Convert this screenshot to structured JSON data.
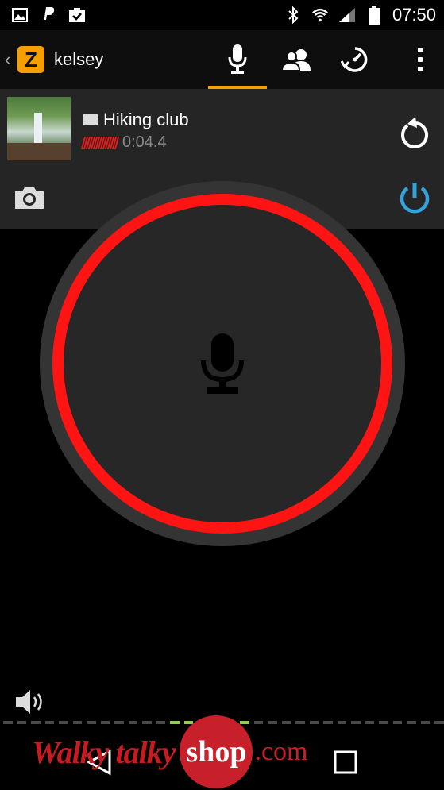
{
  "status_bar": {
    "time": "07:50",
    "left_icons": [
      "image-icon",
      "paypal-icon",
      "clipboard-check-icon"
    ],
    "right_icons": [
      "bluetooth-icon",
      "wifi-icon",
      "signal-icon",
      "battery-icon"
    ]
  },
  "app_bar": {
    "back_glyph": "‹",
    "logo_letter": "Z",
    "title": "kelsey",
    "tabs": [
      {
        "icon": "microphone-icon",
        "active": true
      },
      {
        "icon": "contacts-icon",
        "active": false
      },
      {
        "icon": "history-icon",
        "active": false
      }
    ],
    "overflow_icon": "more-vert-icon",
    "accent_color": "#f5a000"
  },
  "message_card": {
    "title": "Hiking club",
    "duration": "0:04.4",
    "waveform_color": "#e21b1b",
    "replay_icon": "replay-icon",
    "camera_icon": "camera-icon",
    "power_icon": "power-icon",
    "power_color": "#33a3dc"
  },
  "ptt": {
    "icon": "microphone-icon",
    "ring_color": "#ff1414"
  },
  "audio": {
    "speaker_icon": "speaker-icon",
    "level_active_color": "#8fd14f",
    "level_fraction": 0.25
  },
  "nav_bar": {
    "icons": [
      "nav-back-icon",
      "nav-home-icon",
      "nav-recents-icon"
    ]
  },
  "watermark": {
    "text": "Walky talky",
    "shop": "shop",
    "suffix": ".com"
  }
}
